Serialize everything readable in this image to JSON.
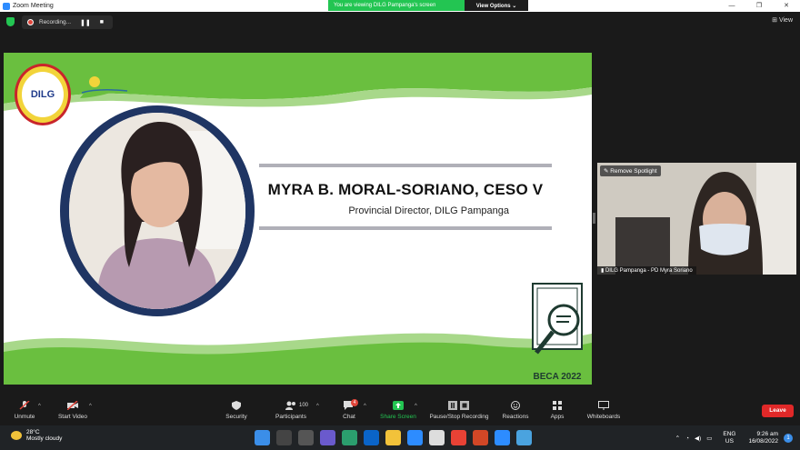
{
  "window": {
    "title": "Zoom Meeting",
    "minimize": "—",
    "restore": "❐",
    "close": "✕"
  },
  "share_banner": {
    "text": "You are viewing DILG Pampanga's screen",
    "options_label": "View Options ⌄"
  },
  "recording": {
    "label": "Recording...",
    "pause": "❚❚",
    "stop": "■"
  },
  "view_button": {
    "label": "⊞ View"
  },
  "slide": {
    "logo_text": "DILG",
    "name": "MYRA B. MORAL-SORIANO, CESO V",
    "position": "Provincial Director, DILG Pampanga",
    "badge": "BECA 2022",
    "colors": {
      "green": "#6abf3f",
      "light_green": "#a8d88a",
      "navy": "#1f3563"
    }
  },
  "spotlight": {
    "remove_label": "Remove Spotlight",
    "participant_name": "DILG Pampanga - PD Myra Soriano"
  },
  "toolbar": {
    "unmute": "Unmute",
    "start_video": "Start Video",
    "security": "Security",
    "participants": "Participants",
    "participant_count": "100",
    "chat": "Chat",
    "chat_badge": "4",
    "share_screen": "Share Screen",
    "recording": "Pause/Stop Recording",
    "reactions": "Reactions",
    "apps": "Apps",
    "whiteboards": "Whiteboards",
    "leave": "Leave"
  },
  "taskbar": {
    "temperature": "28°C",
    "weather": "Mostly cloudy",
    "lang_line1": "ENG",
    "lang_line2": "US",
    "time": "9:26 am",
    "date": "16/08/2022",
    "notifications": "1"
  }
}
